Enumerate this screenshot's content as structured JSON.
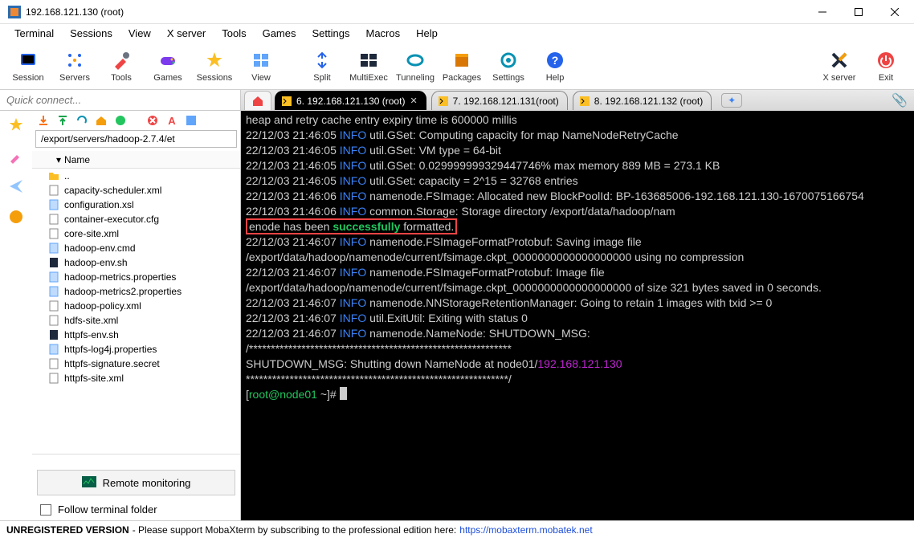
{
  "window": {
    "title": "192.168.121.130 (root)"
  },
  "menu": {
    "items": [
      "Terminal",
      "Sessions",
      "View",
      "X server",
      "Tools",
      "Games",
      "Settings",
      "Macros",
      "Help"
    ]
  },
  "toolbar": {
    "items": [
      "Session",
      "Servers",
      "Tools",
      "Games",
      "Sessions",
      "View",
      "Split",
      "MultiExec",
      "Tunneling",
      "Packages",
      "Settings",
      "Help"
    ],
    "right": [
      "X server",
      "Exit"
    ]
  },
  "quick_connect": {
    "placeholder": "Quick connect..."
  },
  "tabs": [
    {
      "label": "6. 192.168.121.130 (root)",
      "active": true
    },
    {
      "label": "7. 192.168.121.131(root)",
      "active": false
    },
    {
      "label": "8. 192.168.121.132 (root)",
      "active": false
    }
  ],
  "sidebar": {
    "path": "/export/servers/hadoop-2.7.4/et",
    "header": "Name",
    "files": [
      "..",
      "capacity-scheduler.xml",
      "configuration.xsl",
      "container-executor.cfg",
      "core-site.xml",
      "hadoop-env.cmd",
      "hadoop-env.sh",
      "hadoop-metrics.properties",
      "hadoop-metrics2.properties",
      "hadoop-policy.xml",
      "hdfs-site.xml",
      "httpfs-env.sh",
      "httpfs-log4j.properties",
      "httpfs-signature.secret",
      "httpfs-site.xml"
    ],
    "remote_monitoring": "Remote monitoring",
    "follow_label": "Follow terminal folder"
  },
  "terminal": {
    "l1": "heap and retry cache entry expiry time is 600000 millis",
    "l2a": "22/12/03 21:46:05 ",
    "l2i": "INFO",
    "l2b": " util.GSet: Computing capacity for map NameNodeRetryCache",
    "l3a": "22/12/03 21:46:05 ",
    "l3i": "INFO",
    "l3b": " util.GSet: VM type       = 64-bit",
    "l4a": "22/12/03 21:46:05 ",
    "l4i": "INFO",
    "l4b": " util.GSet: 0.029999999329447746% max memory 889 MB = 273.1 KB",
    "l5a": "22/12/03 21:46:05 ",
    "l5i": "INFO",
    "l5b": " util.GSet: capacity      = 2^15 = 32768 entries",
    "l6a": "22/12/03 21:46:06 ",
    "l6i": "INFO",
    "l6b": " namenode.FSImage: Allocated new BlockPoolId: BP-163685006-192.168.121.130-1670075166754",
    "l7a": "22/12/03 21:46:06 ",
    "l7i": "INFO",
    "l7b": " common.Storage: Storage directory /export/data/hadoop/nam",
    "l7c": "enode has been ",
    "l7s": "successfully",
    "l7d": " formatted.",
    "l8a": "22/12/03 21:46:07 ",
    "l8i": "INFO",
    "l8b": " namenode.FSImageFormatProtobuf: Saving image file /export/data/hadoop/namenode/current/fsimage.ckpt_0000000000000000000 using no compression",
    "l9a": "22/12/03 21:46:07 ",
    "l9i": "INFO",
    "l9b": " namenode.FSImageFormatProtobuf: Image file /export/data/hadoop/namenode/current/fsimage.ckpt_0000000000000000000 of size 321 bytes saved in 0 seconds.",
    "l10a": "22/12/03 21:46:07 ",
    "l10i": "INFO",
    "l10b": " namenode.NNStorageRetentionManager: Going to retain 1 images with txid >= 0",
    "l11a": "22/12/03 21:46:07 ",
    "l11i": "INFO",
    "l11b": " util.ExitUtil: Exiting with status 0",
    "l12a": "22/12/03 21:46:07 ",
    "l12i": "INFO",
    "l12b": " namenode.NameNode: SHUTDOWN_MSG:",
    "stars1": "/************************************************************",
    "sdmsg_a": "SHUTDOWN_MSG: Shutting down NameNode at node01/",
    "sdmsg_ip": "192.168.121.130",
    "stars2": "************************************************************/",
    "prompt_a": "[",
    "prompt_user": "root@node01",
    "prompt_b": " ~]# "
  },
  "status": {
    "unreg": "UNREGISTERED VERSION",
    "msg": "  -  Please support MobaXterm by subscribing to the professional edition here:  ",
    "link": "https://mobaxterm.mobatek.net"
  }
}
